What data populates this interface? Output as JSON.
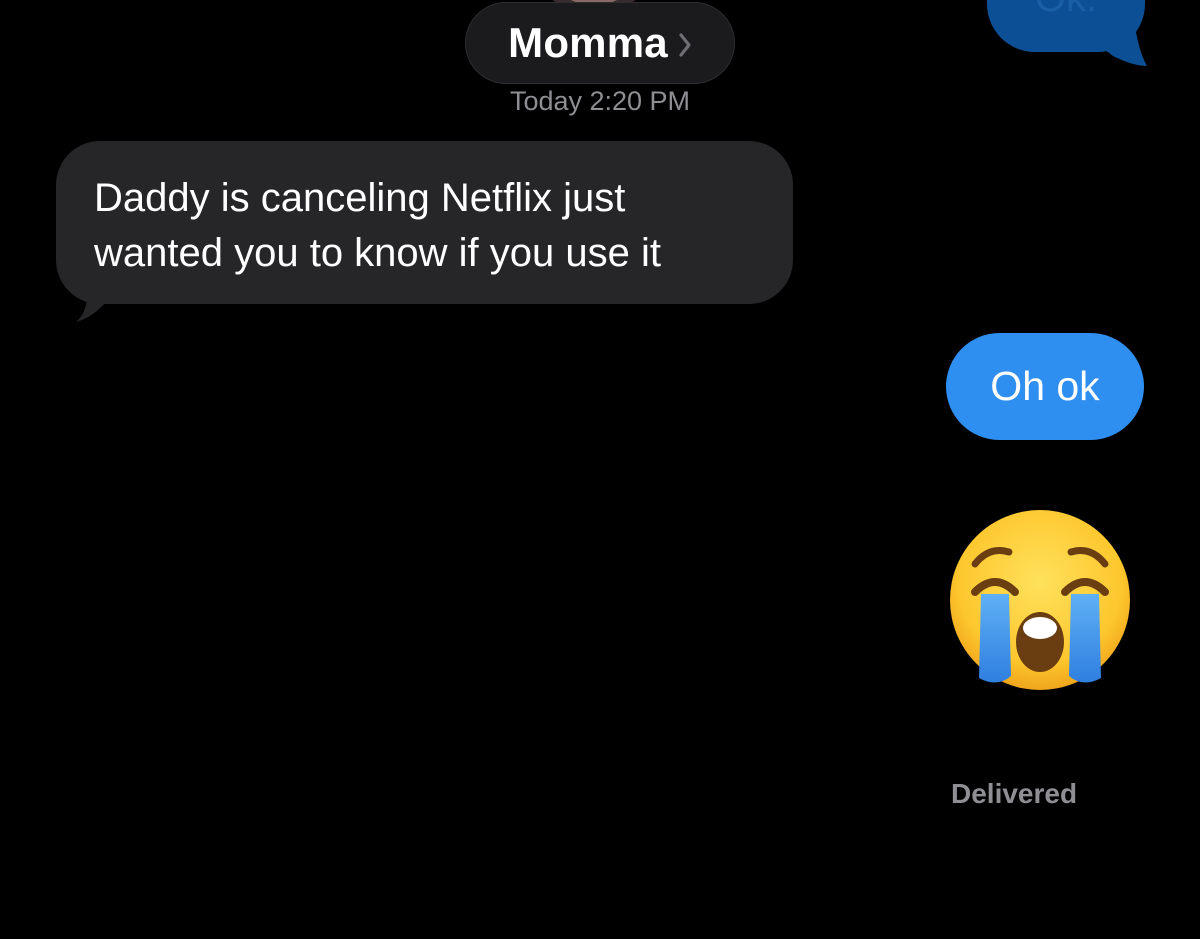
{
  "header": {
    "contact_name": "Momma",
    "timestamp": "Today 2:20 PM"
  },
  "messages": {
    "previous_outgoing": "Ok.",
    "incoming_line1": "Daddy is canceling Netflix just",
    "incoming_line2": "wanted you to know if you use it",
    "outgoing_text": "Oh ok",
    "outgoing_emoji": "loudly-crying-face"
  },
  "status": {
    "delivered": "Delivered"
  },
  "icons": {
    "chevron": "chevron-right-icon"
  },
  "colors": {
    "background": "#000000",
    "incoming_bubble": "#262629",
    "outgoing_bubble": "#2f8ff0",
    "secondary_text": "#8e8e93"
  }
}
